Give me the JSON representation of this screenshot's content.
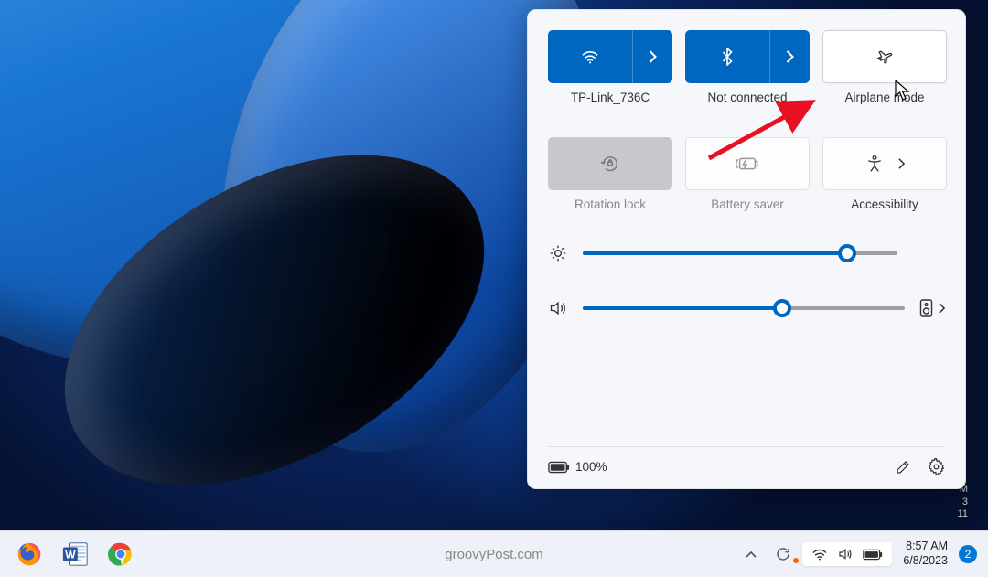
{
  "panel": {
    "tiles": {
      "wifi": {
        "label": "TP-Link_736C",
        "active": true
      },
      "bluetooth": {
        "label": "Not connected",
        "active": true
      },
      "airplane": {
        "label": "Airplane mode",
        "active": false
      },
      "rotation": {
        "label": "Rotation lock",
        "enabled": false
      },
      "battery": {
        "label": "Battery saver",
        "enabled": false
      },
      "accessibility": {
        "label": "Accessibility",
        "enabled": true
      }
    },
    "brightness_percent": 84,
    "volume_percent": 62,
    "battery_text": "100%"
  },
  "taskbar": {
    "watermark": "groovyPost.com",
    "time": "8:57 AM",
    "date": "6/8/2023",
    "notifications": "2"
  }
}
